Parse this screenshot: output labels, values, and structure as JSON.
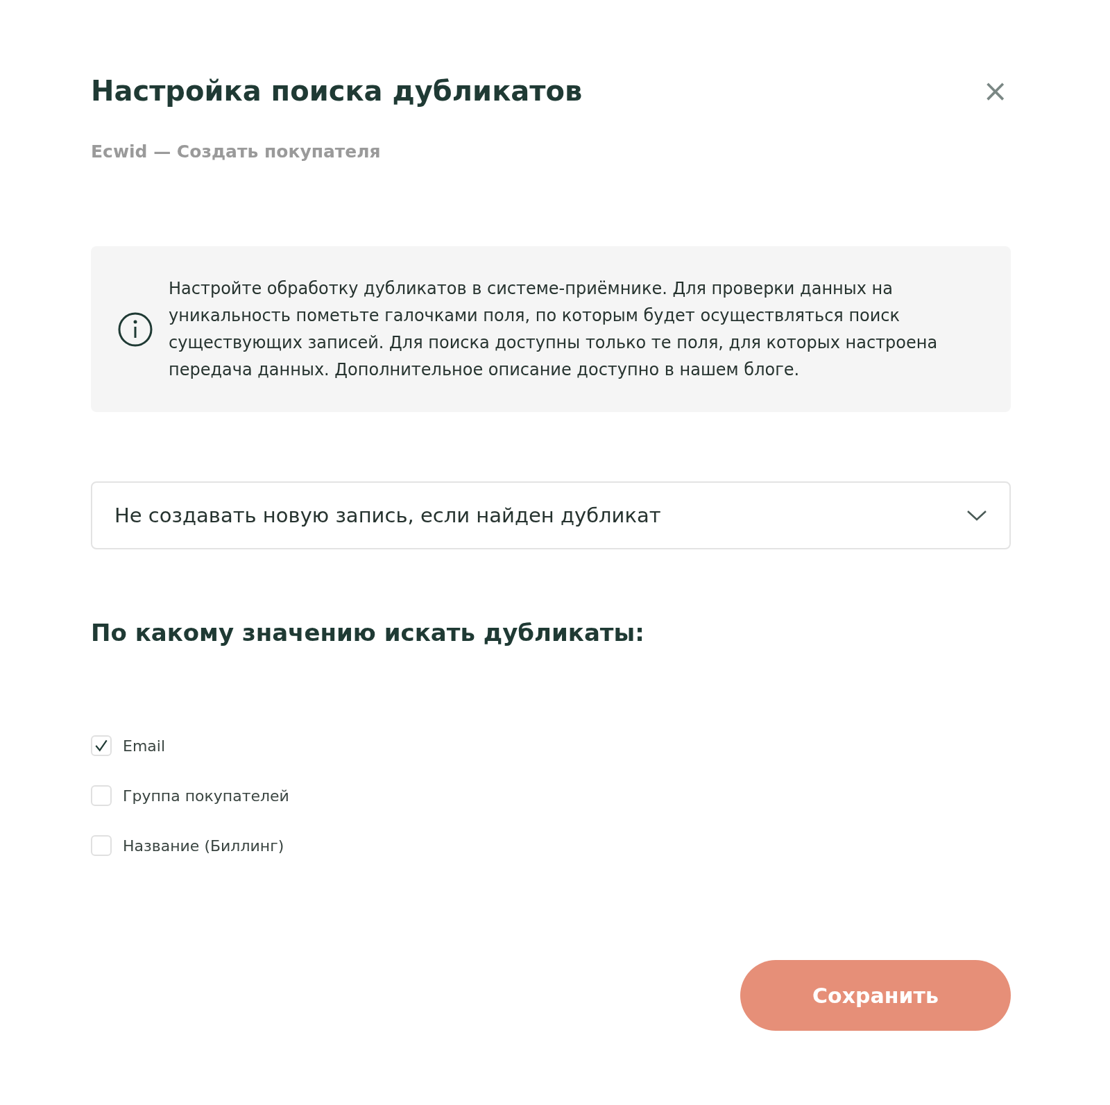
{
  "dialog": {
    "title": "Настройка поиска дубликатов",
    "subtitle": "Ecwid — Создать покупателя",
    "close": "×"
  },
  "info": {
    "text": "Настройте обработку дубликатов в системе-приёмнике. Для проверки данных на уникальность пометьте галочками поля, по которым будет осуществляться поиск существующих записей. Для поиска доступны только те поля, для которых настроена передача данных. Дополнительное описание доступно в нашем блоге."
  },
  "mode_select": {
    "value": "Не создавать новую запись, если найден дубликат"
  },
  "fields_heading": "По какому значению искать дубликаты:",
  "fields": [
    {
      "label": "Email",
      "checked": true
    },
    {
      "label": "Группа покупателей",
      "checked": false
    },
    {
      "label": "Название (Биллинг)",
      "checked": false
    }
  ],
  "save_button": "Сохранить"
}
